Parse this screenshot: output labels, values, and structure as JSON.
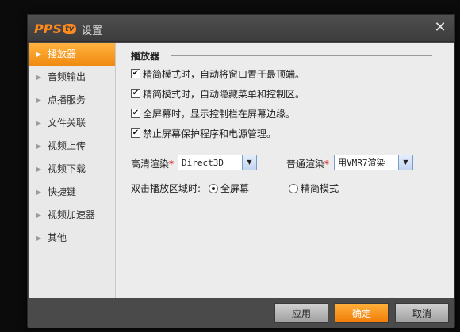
{
  "window": {
    "app_logo": "PPS",
    "app_logo_badge": "tv",
    "title": "设置",
    "close_glyph": "✕"
  },
  "sidebar": {
    "items": [
      {
        "label": "播放器",
        "active": true
      },
      {
        "label": "音频输出"
      },
      {
        "label": "点播服务"
      },
      {
        "label": "文件关联"
      },
      {
        "label": "视频上传"
      },
      {
        "label": "视频下载"
      },
      {
        "label": "快捷键"
      },
      {
        "label": "视频加速器"
      },
      {
        "label": "其他"
      }
    ]
  },
  "panel": {
    "section_title": "播放器",
    "options": [
      {
        "label": "精简模式时，自动将窗口置于最顶端。",
        "checked": true
      },
      {
        "label": "精简模式时，自动隐藏菜单和控制区。",
        "checked": true
      },
      {
        "label": "全屏幕时，显示控制栏在屏幕边缘。",
        "checked": true
      },
      {
        "label": "禁止屏幕保护程序和电源管理。",
        "checked": true
      }
    ],
    "hd_render": {
      "label": "高清渲染",
      "required_mark": "*",
      "value": "Direct3D"
    },
    "normal_render": {
      "label": "普通渲染",
      "required_mark": "*",
      "value": "用VMR7渲染"
    },
    "double_click": {
      "label": "双击播放区域时:",
      "options": [
        {
          "label": "全屏幕",
          "selected": true
        },
        {
          "label": "精简模式",
          "selected": false
        }
      ]
    }
  },
  "footer": {
    "apply_label": "应用",
    "ok_label": "确定",
    "cancel_label": "取消"
  },
  "colors": {
    "accent": "#f39218",
    "dialog_bg": "#4a4a4a",
    "content_bg": "#ececec"
  }
}
